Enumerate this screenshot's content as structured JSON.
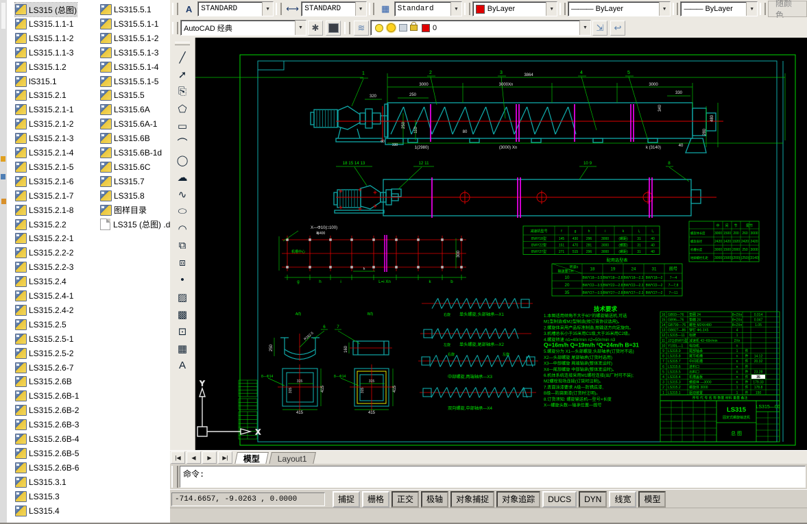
{
  "colors": {
    "frame_green": "#00d800",
    "entity_teal": "#10a8a8",
    "centerline_red": "#e00000",
    "section_magenta": "#ff00ff",
    "aux_yellow": "#e8e800",
    "canvas_bg": "#000000",
    "chrome": "#ece9e2"
  },
  "file_panel": {
    "col1": [
      "LS315 (总图)",
      "LS315.1.1-1",
      "LS315.1.1-2",
      "LS315.1.1-3",
      "LS315.1.2",
      "lS315.1",
      "LS315.2.1",
      "LS315.2.1-1",
      "LS315.2.1-2",
      "LS315.2.1-3",
      "LS315.2.1-4",
      "LS315.2.1-5",
      "LS315.2.1-6",
      "LS315.2.1-7",
      "LS315.2.1-8",
      "LS315.2.2",
      "LS315.2.2-1",
      "LS315.2.2-2",
      "LS315.2.2-3",
      "LS315.2.4",
      "LS315.2.4-1",
      "LS315.2.4-2",
      "LS315.2.5",
      "LS315.2.5-1",
      "LS315.2.5-2",
      "LS315.2.6-7",
      "LS315.2.6B",
      "LS315.2.6B-1",
      "LS315.2.6B-2",
      "LS315.2.6B-3",
      "LS315.2.6B-4",
      "LS315.2.6B-5",
      "LS315.2.6B-6",
      "LS315.3.1",
      "LS315.3",
      "LS315.4"
    ],
    "col2": [
      "LS315.5.1",
      "LS315.5.1-1",
      "LS315.5.1-2",
      "LS315.5.1-3",
      "LS315.5.1-4",
      "LS315.5.1-5",
      "LS315.5",
      "LS315.6A",
      "LS315.6A-1",
      "LS315.6B",
      "LS315.6B-1d",
      "LS315.6C",
      "LS315.7",
      "LS315.8",
      "图样目录"
    ],
    "plain_doc": "LS315 (总图) .d",
    "selected_index": 0
  },
  "toolbar1": {
    "text_style": "STANDARD",
    "dim_style": "STANDARD",
    "table_style": "Standard",
    "color": "ByLayer",
    "linetype": "ByLayer",
    "lineweight": "ByLayer",
    "plot_style": "随颜色",
    "linetype_glyph": "—·—·—",
    "lineweight_glyph": "———"
  },
  "toolbar2": {
    "workspace": "AutoCAD 经典",
    "layer_name": "0"
  },
  "draw_tools": [
    {
      "name": "line",
      "glyph": "╱"
    },
    {
      "name": "construction-line",
      "glyph": "➚"
    },
    {
      "name": "polyline",
      "glyph": "⎘"
    },
    {
      "name": "polygon",
      "glyph": "⬠"
    },
    {
      "name": "rectangle",
      "glyph": "▭"
    },
    {
      "name": "arc",
      "glyph": "⌒"
    },
    {
      "name": "circle",
      "glyph": "◯"
    },
    {
      "name": "revision-cloud",
      "glyph": "☁"
    },
    {
      "name": "spline",
      "glyph": "∿"
    },
    {
      "name": "ellipse",
      "glyph": "⬭"
    },
    {
      "name": "ellipse-arc",
      "glyph": "◠"
    },
    {
      "name": "insert-block",
      "glyph": "⧉"
    },
    {
      "name": "make-block",
      "glyph": "⧈"
    },
    {
      "name": "point",
      "glyph": "•"
    },
    {
      "name": "hatch",
      "glyph": "▨"
    },
    {
      "name": "gradient",
      "glyph": "▩"
    },
    {
      "name": "region",
      "glyph": "⊡"
    },
    {
      "name": "table",
      "glyph": "▦"
    },
    {
      "name": "multiline-text",
      "glyph": "A"
    }
  ],
  "canvas": {
    "balloons": [
      "1",
      "2",
      "3",
      "4",
      "5"
    ],
    "view1": {
      "dim_overall": "3864",
      "dim_3000": "3000",
      "dim_3000xn": "3000Xn",
      "dim_3000r": "3000",
      "dim_320": "320",
      "dim_250": "250",
      "dim_330r": "330",
      "v250": "250",
      "v110": "110",
      "v80": "80",
      "v340": "340",
      "v480": "480",
      "v280": "280",
      "b60": "60",
      "b330": "330",
      "b2980": "1(2980)",
      "b3000xn": "(3000) Xn",
      "b3140": "k (3140)",
      "b40": "40"
    },
    "view2": {
      "g1": "18  15  14  13",
      "g2": "12  11",
      "g3": "10  9",
      "g4": "8"
    },
    "grid": {
      "label": "X—Φ10(□100)",
      "sub": "每400",
      "note": "机槽中心",
      "dim300": "300",
      "dimh": "h",
      "letters": [
        "g",
        "h",
        "i",
        "L=i Xn",
        "k",
        "b"
      ]
    },
    "sections": {
      "t1": "A向",
      "t2": "B向",
      "b6": "6",
      "b7": "7",
      "d250": "250",
      "r": "R162.5",
      "d160": "160",
      "d315": "315",
      "d415": "415",
      "holes1": "8—Φ14",
      "holes2": "8—Φ14"
    },
    "xdetails": {
      "x1dir": "右旋",
      "x1": "单头螺旋,头部轴承—X1",
      "x2dir": "左旋",
      "x2": "单头螺旋,尾部轴承—X2",
      "x3l": "右旋",
      "x3r": "左旋",
      "x3": "中部螺旋,两端轴承—X3",
      "x4": "双向螺旋,中部轴承—X4"
    },
    "notes_title": "技术要求",
    "notes": [
      "1.本图适用倾角不大于60°的螺旋输送机,可选",
      "  M1型制造或M2型制造(按订货协议选用)。",
      "2.螺旋体采用产品标准制造,按输送方向定旋向。",
      "3.机槽总长小于35米用C1级,大于35米用C2级。",
      "4.螺旋转速 n1=40r/min  n2=50r/min  n3",
      "Q=16m/h   Q=19m/h  ²Q=24m/h   B=31",
      "5.螺旋分为 X1—头部螺旋,头部轴承(订货时不选)",
      "X2—头部螺旋  尾部轴承(订货时选用)",
      "X3—中部螺旋  两端轴承(整体发运时)",
      "X4—尾部螺旋  中部轴承(整体发运时)。",
      "6.机体系统连接采用M1螺栓连接(出厂时可不装);",
      "  M2螺栓现场连接(订货时注明)。",
      "7.表面涂漆要求 A级—防锈底漆,",
      "  B级—防腐面漆(订货时注明)。",
      "8.订货须知: 螺旋输送机—型号×长度",
      "  X—螺旋头数—轴承位置—图号"
    ],
    "tableA": {
      "header": [
        "减速机型号",
        "f",
        "g",
        "h",
        "i",
        "k",
        "l₁",
        "l₂"
      ],
      "rows": [
        [
          "BWY18型",
          "145",
          "430",
          "296",
          "3000",
          "(螺距)",
          "31",
          "40"
        ],
        [
          "BWY22型",
          "151",
          "470",
          "281",
          "3000",
          "(螺距)",
          "31",
          "40"
        ],
        [
          "BWY27型",
          "271",
          "515",
          "296",
          "3000",
          "(螺距)",
          "31",
          "40"
        ]
      ]
    },
    "tableB": {
      "caption": "配用选型表",
      "corner_top": "转速n",
      "corner_bottom": "输送量T/H",
      "cols": [
        "18",
        "19",
        "24",
        "31",
        "图号"
      ],
      "rows": [
        [
          "10",
          "BWY18—3.5",
          "BWY18—2.8",
          "BWY18—2.3",
          "BWY18—2",
          "7—4"
        ],
        [
          "20",
          "BWY22—3.5",
          "BWY22—2.8",
          "BWY22—2.3",
          "BWY22—2",
          "7—7,8"
        ],
        [
          "35",
          "BWY27—3.5",
          "BWY27—2.8",
          "BWY27—2.3",
          "BWY27—2",
          "7—11"
        ]
      ]
    },
    "tableC": {
      "top": [
        "中",
        "间",
        "节",
        "尾节"
      ],
      "rows": [
        [
          "螺旋体长度",
          "3000",
          "1500",
          "200",
          "260",
          "3000"
        ],
        [
          "螺旋直径",
          "2420",
          "1420",
          "1920",
          "2420",
          "2420"
        ],
        [
          "机槽长度",
          "3000",
          "1500",
          "2000",
          "250",
          "3000"
        ],
        [
          "地脚螺栓孔距",
          "3000",
          "(1500)",
          "(200)",
          "(250)",
          "(3140)"
        ]
      ]
    },
    "bom": {
      "rows": [
        [
          "16",
          "GB93—76",
          "垫圈 24",
          "8+2Xn",
          "",
          "0.014"
        ],
        [
          "15",
          "GB96—76",
          "垫圈 24",
          "8+2Xn",
          "",
          "0.047"
        ],
        [
          "14",
          "GB799—76",
          "螺栓 M24X480",
          "8+2Xn",
          "",
          "1.05"
        ],
        [
          "13",
          "GB827—86",
          "铆钉 Φ6.3X5",
          "4",
          "",
          ""
        ],
        [
          "12",
          "LS315—11",
          "标牌",
          "1",
          "",
          ""
        ],
        [
          "11",
          "JZQ(BWY)型",
          "减速机 43~60r/min",
          "2Xn",
          "",
          ""
        ],
        [
          "10",
          "Y100L—1",
          "电动机",
          "n",
          "",
          ""
        ],
        [
          "9",
          "LS315.9",
          "尾部轴承",
          "1",
          "件",
          ""
        ],
        [
          "8",
          "LS315.8",
          "尾节机槽",
          "n",
          "件",
          "14.12"
        ],
        [
          "7",
          "LS315.7",
          "中间机槽",
          "n",
          "件",
          "20.32"
        ],
        [
          "6",
          "LS315.6",
          "进料口",
          "n",
          "件",
          ""
        ],
        [
          "5",
          "LS315.5",
          "出料口",
          "n",
          "件",
          "23.28"
        ],
        [
          "4",
          "LS315.4",
          "机槽盖板",
          "n",
          "件",
          "35"
        ],
        [
          "3",
          "LS315.3",
          "螺旋体 —3000",
          "n",
          "件",
          "179.33"
        ],
        [
          "2",
          "LS315.2",
          "螺旋体 3000",
          "1",
          "件",
          "178.8"
        ],
        [
          "1",
          "LS315.1",
          "驱动装置",
          "1",
          "件",
          "150"
        ]
      ],
      "header": "序号   代 号   名 称   数量 材料 重量 备注",
      "highlight_row": 12
    },
    "title_block": {
      "model": "LS315",
      "product": "固定式螺旋输送机",
      "sheet": "总  图",
      "drawing_no": "LS315—00"
    },
    "ucs": {
      "x": "X",
      "y": "Y"
    }
  },
  "tabs": {
    "nav": [
      "|◀",
      "◀",
      "▶",
      "▶|"
    ],
    "model": "模型",
    "layout": "Layout1"
  },
  "command_line": {
    "prompt": "命令:"
  },
  "status_bar": {
    "coords": "-714.6657, -9.0263 ,  0.0000",
    "toggles": [
      {
        "label": "捕捉",
        "pressed": false
      },
      {
        "label": "栅格",
        "pressed": false
      },
      {
        "label": "正交",
        "pressed": true
      },
      {
        "label": "极轴",
        "pressed": true
      },
      {
        "label": "对象捕捉",
        "pressed": true
      },
      {
        "label": "对象追踪",
        "pressed": true
      },
      {
        "label": "DUCS",
        "pressed": false
      },
      {
        "label": "DYN",
        "pressed": true
      },
      {
        "label": "线宽",
        "pressed": false
      },
      {
        "label": "模型",
        "pressed": true
      }
    ]
  }
}
